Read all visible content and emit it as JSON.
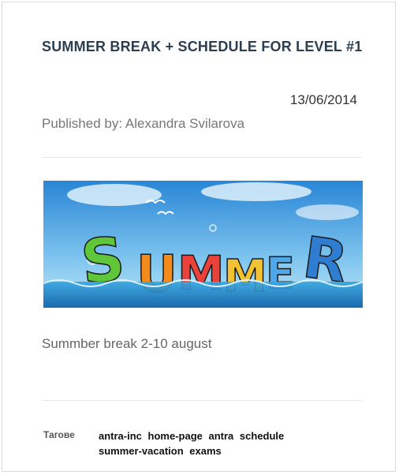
{
  "post": {
    "title": "SUMMER BREAK + SCHEDULE FOR LEVEL #1",
    "date": "13/06/2014",
    "published_by_label": "Published by:",
    "author": "Alexandra Svilarova",
    "banner_icon": "summer-banner-image",
    "excerpt": "Summber break 2-10 august"
  },
  "tags": {
    "label": "Тагове",
    "items": [
      "antra-inc",
      "home-page",
      "antra",
      "schedule",
      "summer-vacation",
      "exams"
    ]
  }
}
